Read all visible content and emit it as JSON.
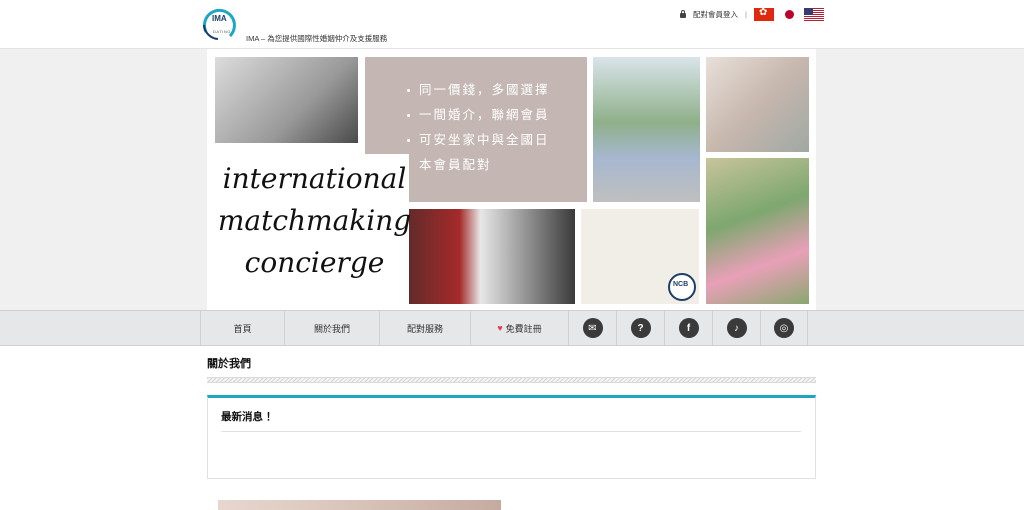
{
  "header": {
    "logo_text": "IMA",
    "logo_sub": "DATING",
    "tagline": "IMA – 為您提供國際性婚姻仲介及支援服務",
    "member_login": "配對會員登入",
    "separator": "|",
    "flags": [
      "hk-flag",
      "jp-flag",
      "us-flag"
    ]
  },
  "banner": {
    "bullets": [
      "同一價錢，多國選擇",
      "一間婚介，聯網會員",
      "可安坐家中與全國日",
      "本會員配對"
    ],
    "script_lines": [
      "international",
      "matchmaking",
      "concierge"
    ],
    "badge_text": "NCB"
  },
  "nav": {
    "items": [
      "首頁",
      "關於我們",
      "配對服務",
      "免費註冊"
    ],
    "icons": [
      "mail-icon",
      "help-icon",
      "facebook-icon",
      "tiktok-icon",
      "instagram-icon"
    ]
  },
  "main": {
    "page_title": "關於我們",
    "news_title": "最新消息 ！"
  },
  "colors": {
    "accent": "#1ea7c2",
    "heart": "#e53950",
    "nav_bg": "#e6e7e9"
  }
}
